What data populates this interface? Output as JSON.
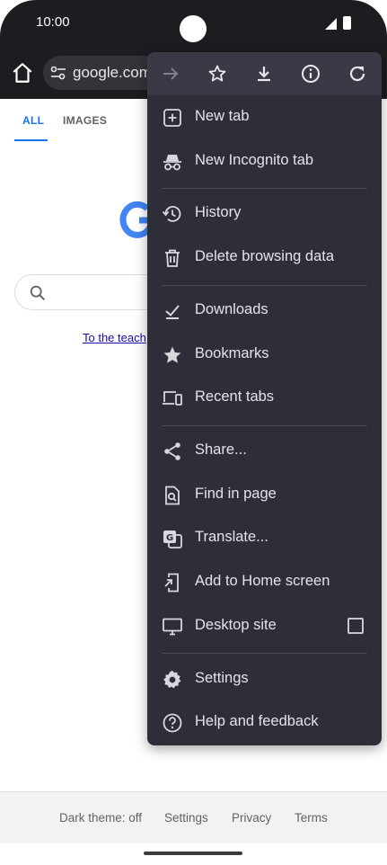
{
  "status_bar": {
    "time": "10:00"
  },
  "toolbar": {
    "url": "google.com"
  },
  "page": {
    "tabs": [
      {
        "label": "ALL"
      },
      {
        "label": "IMAGES"
      }
    ],
    "teach_link": "To the teach",
    "footer": {
      "dark_theme": "Dark theme: off",
      "settings": "Settings",
      "privacy": "Privacy",
      "terms": "Terms"
    }
  },
  "menu": {
    "top_icons": [
      "forward-icon",
      "bookmark-star-icon",
      "download-icon",
      "info-icon",
      "reload-icon"
    ],
    "items": [
      {
        "label": "New tab",
        "icon": "new-tab-icon"
      },
      {
        "label": "New Incognito tab",
        "icon": "incognito-icon"
      },
      {
        "label": "History",
        "icon": "history-icon"
      },
      {
        "label": "Delete browsing data",
        "icon": "trash-icon"
      },
      {
        "label": "Downloads",
        "icon": "downloads-icon"
      },
      {
        "label": "Bookmarks",
        "icon": "star-icon"
      },
      {
        "label": "Recent tabs",
        "icon": "devices-icon"
      },
      {
        "label": "Share...",
        "icon": "share-icon"
      },
      {
        "label": "Find in page",
        "icon": "find-in-page-icon"
      },
      {
        "label": "Translate...",
        "icon": "translate-icon"
      },
      {
        "label": "Add to Home screen",
        "icon": "add-to-home-icon"
      },
      {
        "label": "Desktop site",
        "icon": "desktop-icon",
        "checked": false
      },
      {
        "label": "Settings",
        "icon": "gear-icon"
      },
      {
        "label": "Help and feedback",
        "icon": "help-icon"
      }
    ]
  },
  "colors": {
    "menu_bg": "#2d2e37",
    "menu_header": "#393a46",
    "accent": "#1a73e8"
  }
}
